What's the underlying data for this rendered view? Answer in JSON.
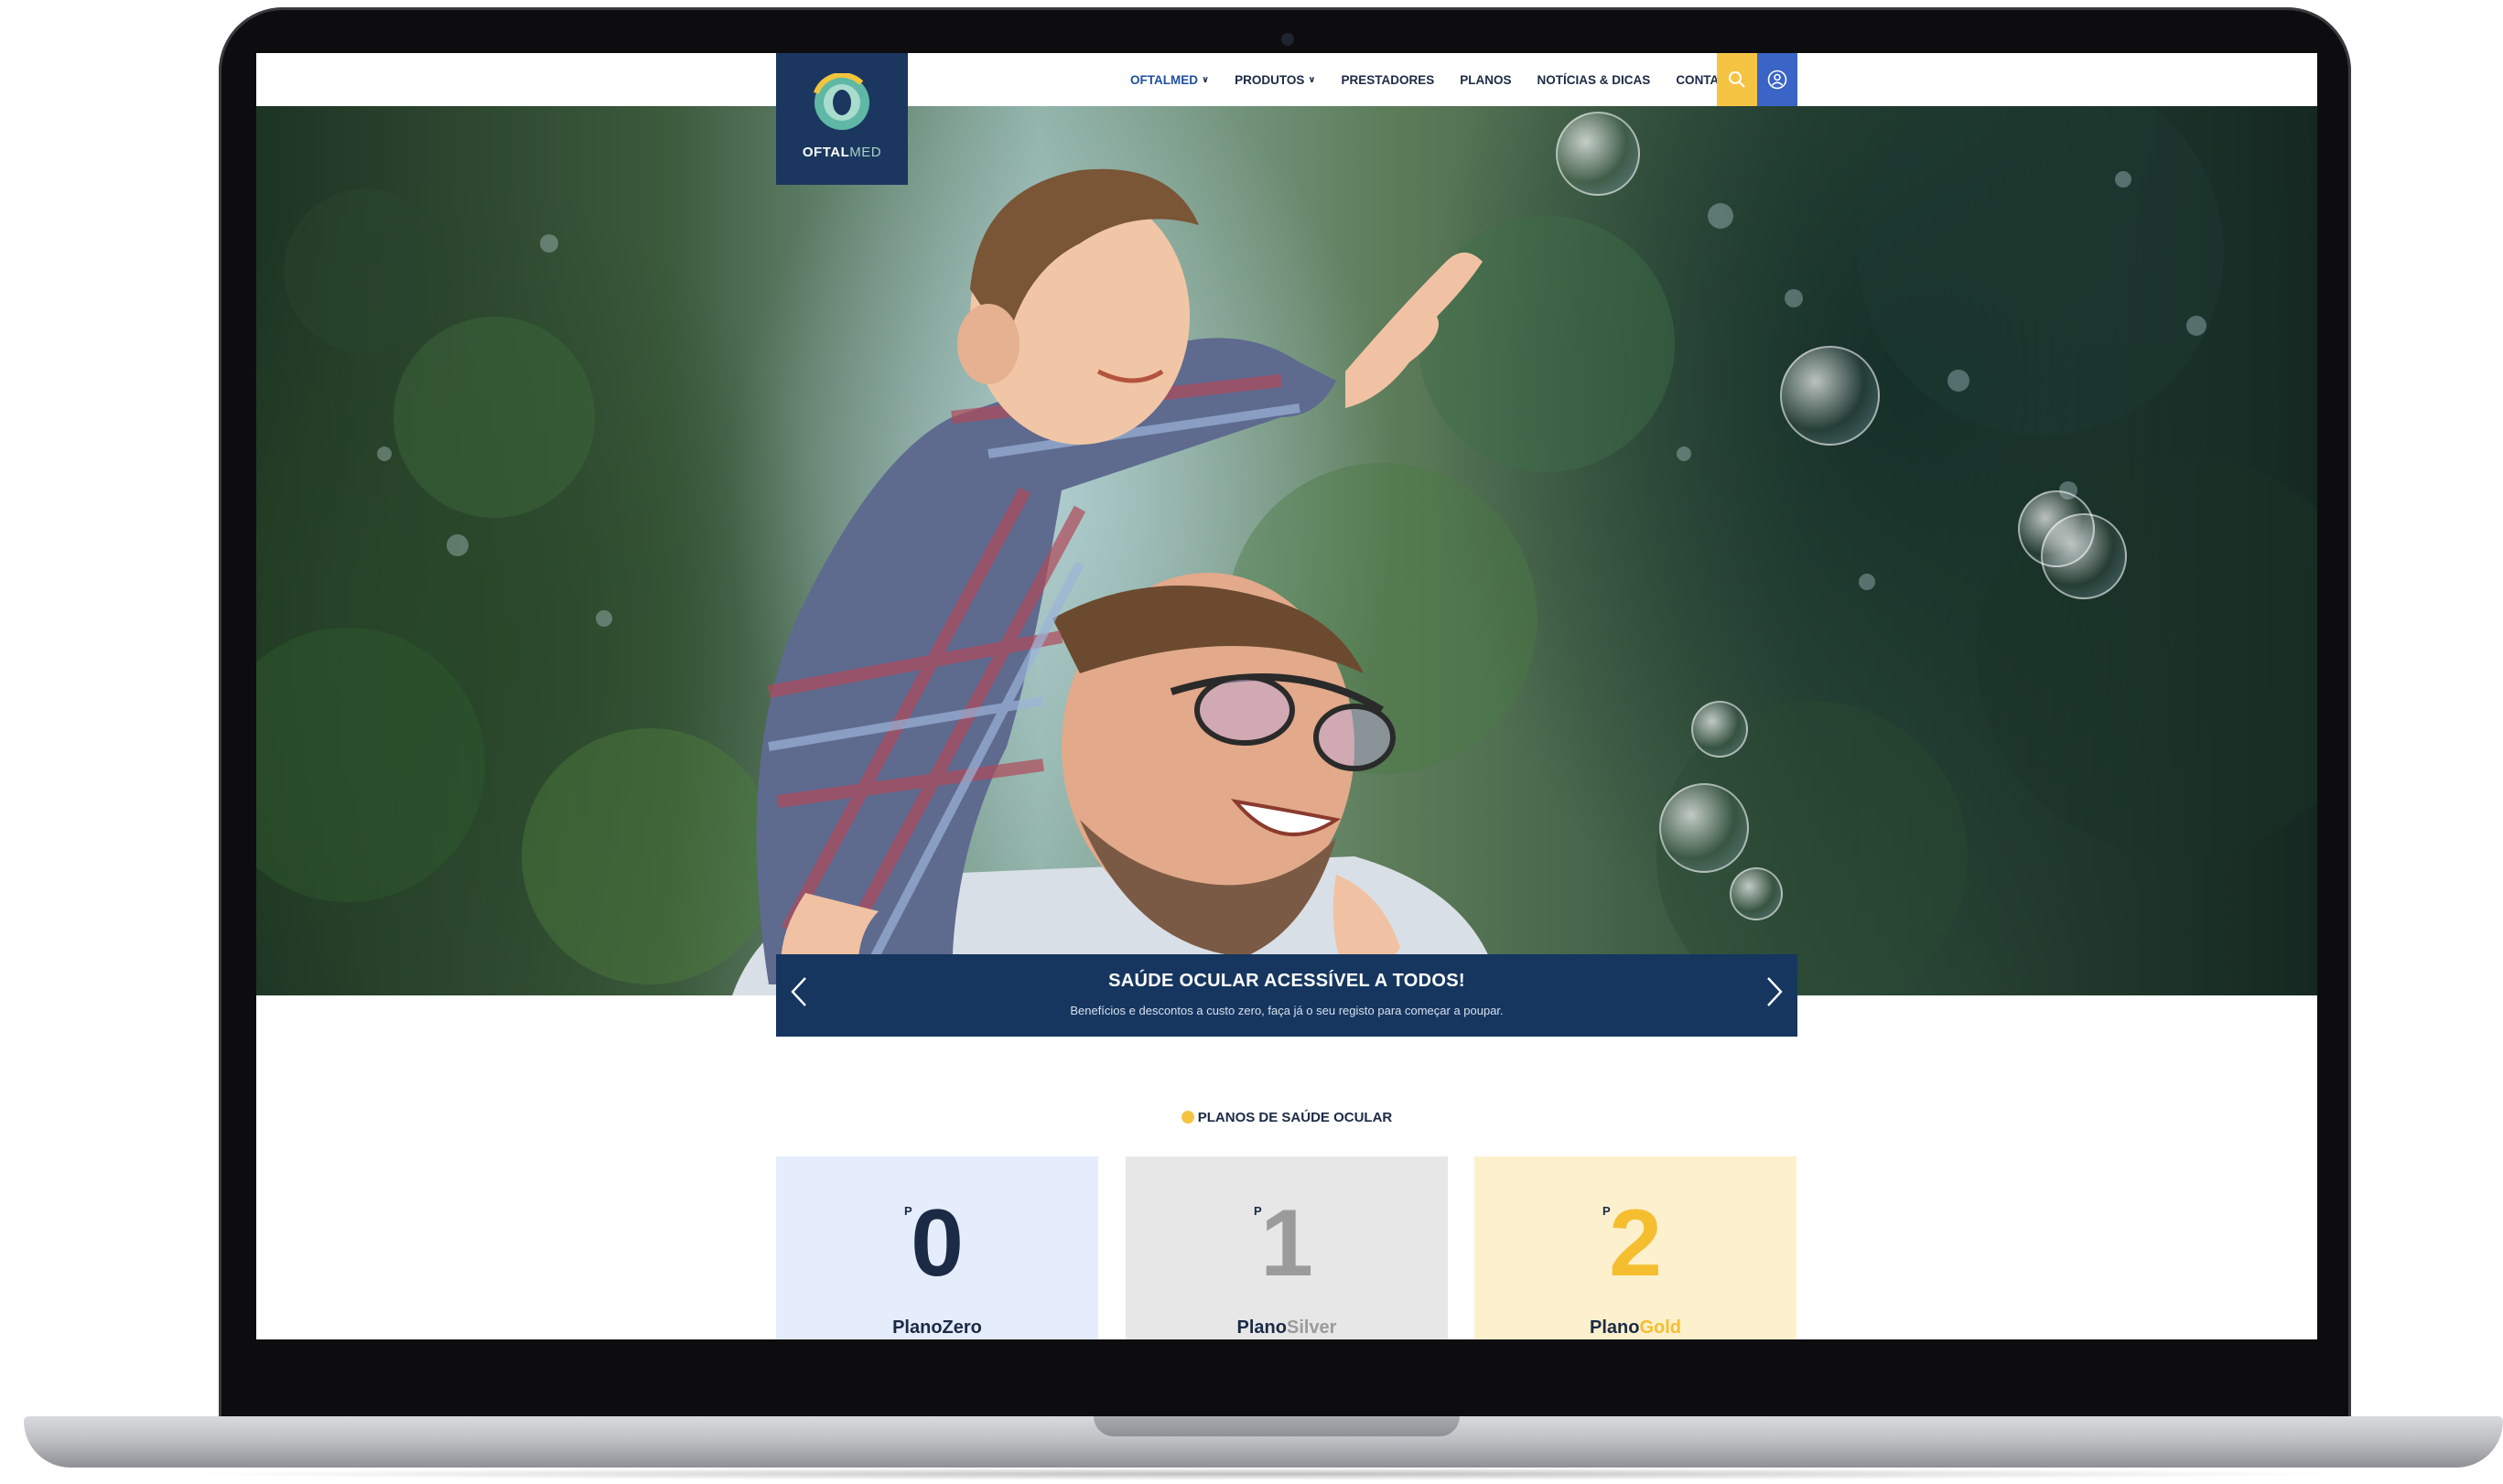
{
  "brand": {
    "name_bold": "OFTAL",
    "name_light": "MED"
  },
  "nav": {
    "items": [
      {
        "label": "OFTALMED",
        "has_dropdown": true,
        "active": true
      },
      {
        "label": "PRODUTOS",
        "has_dropdown": true,
        "active": false
      },
      {
        "label": "PRESTADORES",
        "has_dropdown": false,
        "active": false
      },
      {
        "label": "PLANOS",
        "has_dropdown": false,
        "active": false
      },
      {
        "label": "NOTÍCIAS & DICAS",
        "has_dropdown": false,
        "active": false
      },
      {
        "label": "CONTACTOS",
        "has_dropdown": false,
        "active": false
      }
    ],
    "search_icon": "search-icon",
    "user_icon": "user-icon"
  },
  "hero": {
    "title": "SAÚDE OCULAR ACESSÍVEL A TODOS!",
    "subtitle": "Benefícios e descontos a custo zero, faça já o seu registo para começar a poupar.",
    "prev_icon": "chevron-left-icon",
    "next_icon": "chevron-right-icon"
  },
  "plans": {
    "section_title": "PLANOS DE SAÚDE OCULAR",
    "cards": [
      {
        "prefix": "P",
        "number": "0",
        "name_a": "Plano",
        "name_b": "Zero",
        "color": "#1b2a45",
        "accent": "#1b2a45"
      },
      {
        "prefix": "P",
        "number": "1",
        "name_a": "Plano",
        "name_b": "Silver",
        "color": "#9b9b9b",
        "accent": "#9b9b9b"
      },
      {
        "prefix": "P",
        "number": "2",
        "name_a": "Plano",
        "name_b": "Gold",
        "color": "#f4be2f",
        "accent": "#f4be2f"
      }
    ]
  },
  "colors": {
    "navy": "#16365f",
    "search_yellow": "#f6c443",
    "user_blue": "#3a64c6"
  }
}
